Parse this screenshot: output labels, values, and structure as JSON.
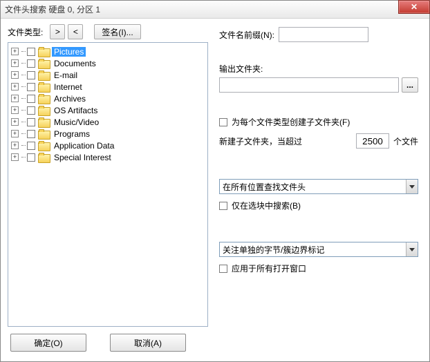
{
  "title": "文件头搜索 硬盘 0, 分区 1",
  "close_x": "✕",
  "left": {
    "file_type_label": "文件类型:",
    "expand_label": ">",
    "collapse_label": "<",
    "signature_label": "签名(I)...",
    "items": [
      {
        "label": "Pictures",
        "selected": true
      },
      {
        "label": "Documents",
        "selected": false
      },
      {
        "label": "E-mail",
        "selected": false
      },
      {
        "label": "Internet",
        "selected": false
      },
      {
        "label": "Archives",
        "selected": false
      },
      {
        "label": "OS Artifacts",
        "selected": false
      },
      {
        "label": "Music/Video",
        "selected": false
      },
      {
        "label": "Programs",
        "selected": false
      },
      {
        "label": "Application Data",
        "selected": false
      },
      {
        "label": "Special Interest",
        "selected": false
      }
    ],
    "expander_glyph": "+"
  },
  "right": {
    "prefix_label": "文件名前缀(N):",
    "prefix_value": "",
    "output_label": "输出文件夹:",
    "output_value": "",
    "browse_label": "...",
    "subfolder_checkbox": "为每个文件类型创建子文件夹(F)",
    "newfolder_line_a": "新建子文件夹，当超过",
    "newfolder_value": "2500",
    "newfolder_line_b": "个文件",
    "dropdown1": "在所有位置查找文件头",
    "only_selected_checkbox": "仅在选块中搜索(B)",
    "dropdown2": "关注单独的字节/簇边界标记",
    "apply_all_checkbox": "应用于所有打开窗口"
  },
  "footer": {
    "ok": "确定(O)",
    "cancel": "取消(A)"
  }
}
